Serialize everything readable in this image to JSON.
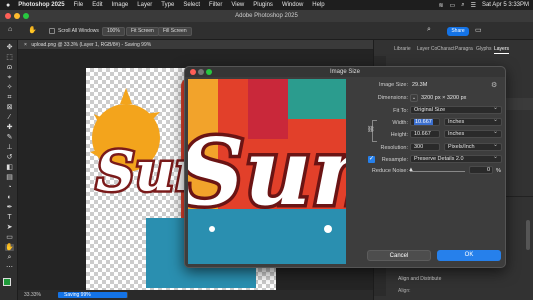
{
  "menubar": {
    "apple": "",
    "app": "Photoshop 2025",
    "items": [
      "File",
      "Edit",
      "Image",
      "Layer",
      "Type",
      "Select",
      "Filter",
      "View",
      "Plugins",
      "Window",
      "Help"
    ],
    "datetime": "Sat Apr 5  3:33PM"
  },
  "window": {
    "title": "Adobe Photoshop 2025"
  },
  "options": {
    "scroll_all_windows": "Scroll All Windows",
    "zoom": "100%",
    "fit_screen": "Fit Screen",
    "fill_screen": "Fill Screen",
    "share": "Share"
  },
  "document": {
    "tab": "upload.png @ 33.3% (Layer 1, RGB/8#) - Saving 99%",
    "artwork_text": "Summer"
  },
  "status": {
    "zoom": "33.33%",
    "progress_label": "Saving 99%",
    "progress": 0.99
  },
  "panels": {
    "tabs": [
      "Librarie",
      "Layer Co",
      "Charact",
      "Paragra",
      "Glyphs",
      "Layers"
    ],
    "align": "Align and Distribute",
    "align_label": "Align:"
  },
  "dialog": {
    "title": "Image Size",
    "image_size_label": "Image Size:",
    "image_size_value": "29.3M",
    "dimensions_label": "Dimensions:",
    "dimensions_value": "3200 px  ×  3200 px",
    "fit_to_label": "Fit To:",
    "fit_to_value": "Original Size",
    "width_label": "Width:",
    "width_value": "10.667",
    "width_unit": "Inches",
    "height_label": "Height:",
    "height_value": "10.667",
    "height_unit": "Inches",
    "resolution_label": "Resolution:",
    "resolution_value": "300",
    "resolution_unit": "Pixels/Inch",
    "resample_label": "Resample:",
    "resample_value": "Preserve Details 2.0",
    "noise_label": "Reduce Noise:",
    "noise_value": "0",
    "noise_unit": "%",
    "cancel": "Cancel",
    "ok": "OK"
  },
  "colors": {
    "accent": "#1473e6",
    "ok_button": "#2680eb",
    "status_progress": "#1473e6"
  }
}
